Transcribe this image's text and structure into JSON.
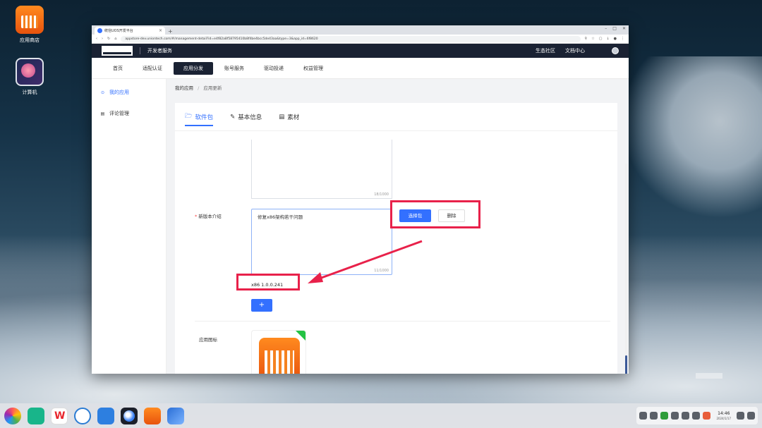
{
  "desktop": {
    "icons": [
      {
        "label": "应用商店"
      },
      {
        "label": "计算机"
      }
    ]
  },
  "browser": {
    "tab_title": "统信UOS开发平台",
    "tab_close": "×",
    "new_tab": "+",
    "window_controls": [
      "–",
      "□",
      "✕"
    ],
    "url": "appstore-dev.uniontech.com/#/management-detail?id=e4f82a8f58795410b8f4be4bcc5de43aa&type=3&app_id=6f8620"
  },
  "header": {
    "developer_service": "开发者服务",
    "links": [
      "生态社区",
      "文档中心"
    ]
  },
  "menu": {
    "items": [
      "首页",
      "适配认证",
      "应用分发",
      "账号服务",
      "驱动投递",
      "权益管理"
    ],
    "active_index": 2
  },
  "sidebar": {
    "items": [
      {
        "label": "我的应用",
        "icon": "app-icon",
        "active": true
      },
      {
        "label": "评论管理",
        "icon": "comment-icon",
        "active": false
      }
    ]
  },
  "breadcrumb": {
    "root": "我的应用",
    "separator": "/",
    "current": "应用更新"
  },
  "tabs": [
    {
      "label": "软件包",
      "icon": "folder-icon",
      "active": true
    },
    {
      "label": "基本信息",
      "icon": "edit-icon",
      "active": false
    },
    {
      "label": "素材",
      "icon": "document-icon",
      "active": false
    }
  ],
  "form": {
    "first_textarea_counter": "18/1000",
    "new_version_label": "新版本介绍",
    "required_mark": "*",
    "new_version_text": "修复x86架构若干问题",
    "new_version_counter": "11/1000",
    "choose_package_button": "选择包",
    "delete_button": "删除",
    "version_label": "x86 1.0.0.241",
    "add_button": "+",
    "app_icon_label": "应用图标"
  },
  "taskbar": {
    "time": "14:46",
    "date": "2024/1/17"
  },
  "colors": {
    "primary": "#3370ff",
    "header_bg": "#1a2233",
    "annotation_red": "#e8214a"
  }
}
